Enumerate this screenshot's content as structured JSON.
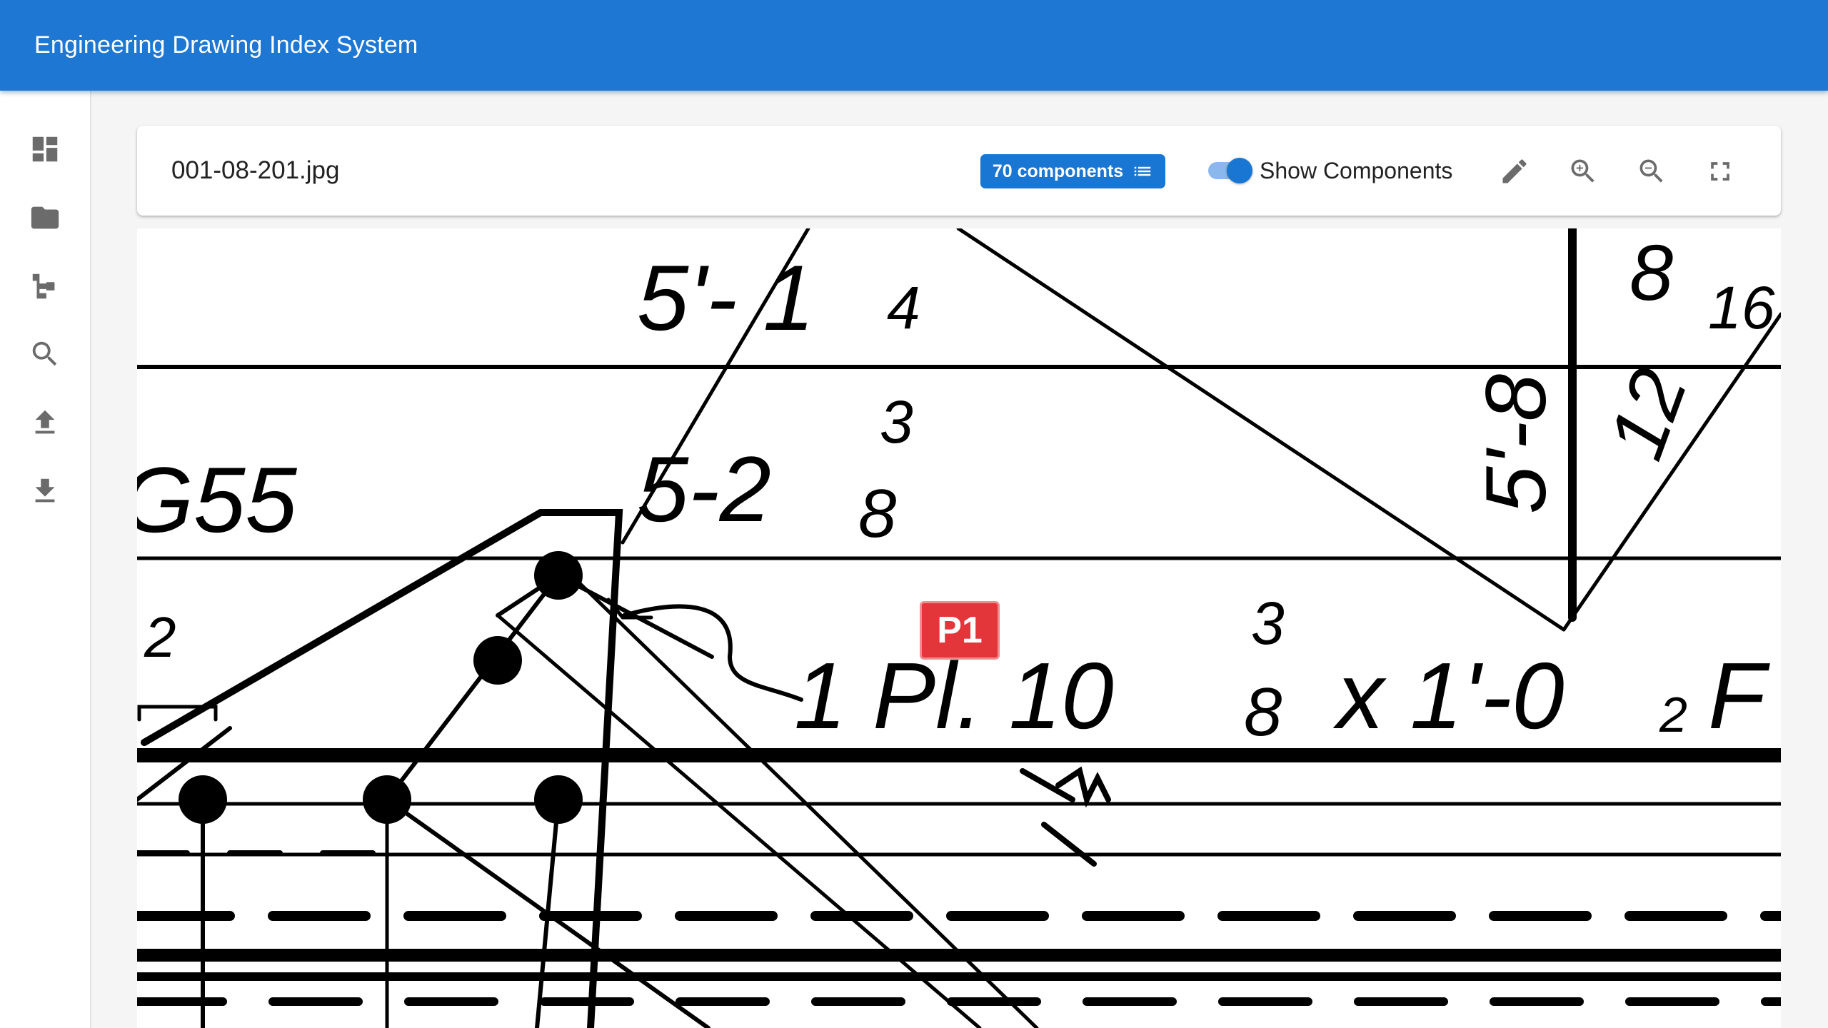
{
  "app": {
    "title": "Engineering Drawing Index System"
  },
  "sidebar": {
    "items": [
      {
        "icon": "dashboard-icon"
      },
      {
        "icon": "folder-icon"
      },
      {
        "icon": "hierarchy-icon"
      },
      {
        "icon": "search-icon"
      },
      {
        "icon": "upload-icon"
      },
      {
        "icon": "download-icon"
      }
    ]
  },
  "toolbar": {
    "filename": "001-08-201.jpg",
    "components_chip": "70 components",
    "show_components_label": "Show Components",
    "show_components_enabled": true,
    "actions": [
      "edit-icon",
      "zoom-in-icon",
      "zoom-out-icon",
      "fullscreen-icon"
    ]
  },
  "drawing": {
    "marker_label": "P1",
    "dimensions": {
      "top_left": "5'- 1",
      "top_left_frac": "4",
      "mid": "5-2",
      "mid_num": "3",
      "mid_den": "8",
      "g55": "G55",
      "half": "2",
      "plate": "1 Pl. 10",
      "plate_num": "3",
      "plate_den": "8",
      "plate_tail": "x 1'-0",
      "plate_tail_frac": "2",
      "plate_tail_end": "F",
      "vertical_a": "5'-8",
      "vertical_b": "12",
      "top_right": "8",
      "top_right_frac": "16"
    }
  },
  "colors": {
    "appbar": "#1e77d3",
    "chip": "#1976d2",
    "marker": "#e2363b"
  }
}
